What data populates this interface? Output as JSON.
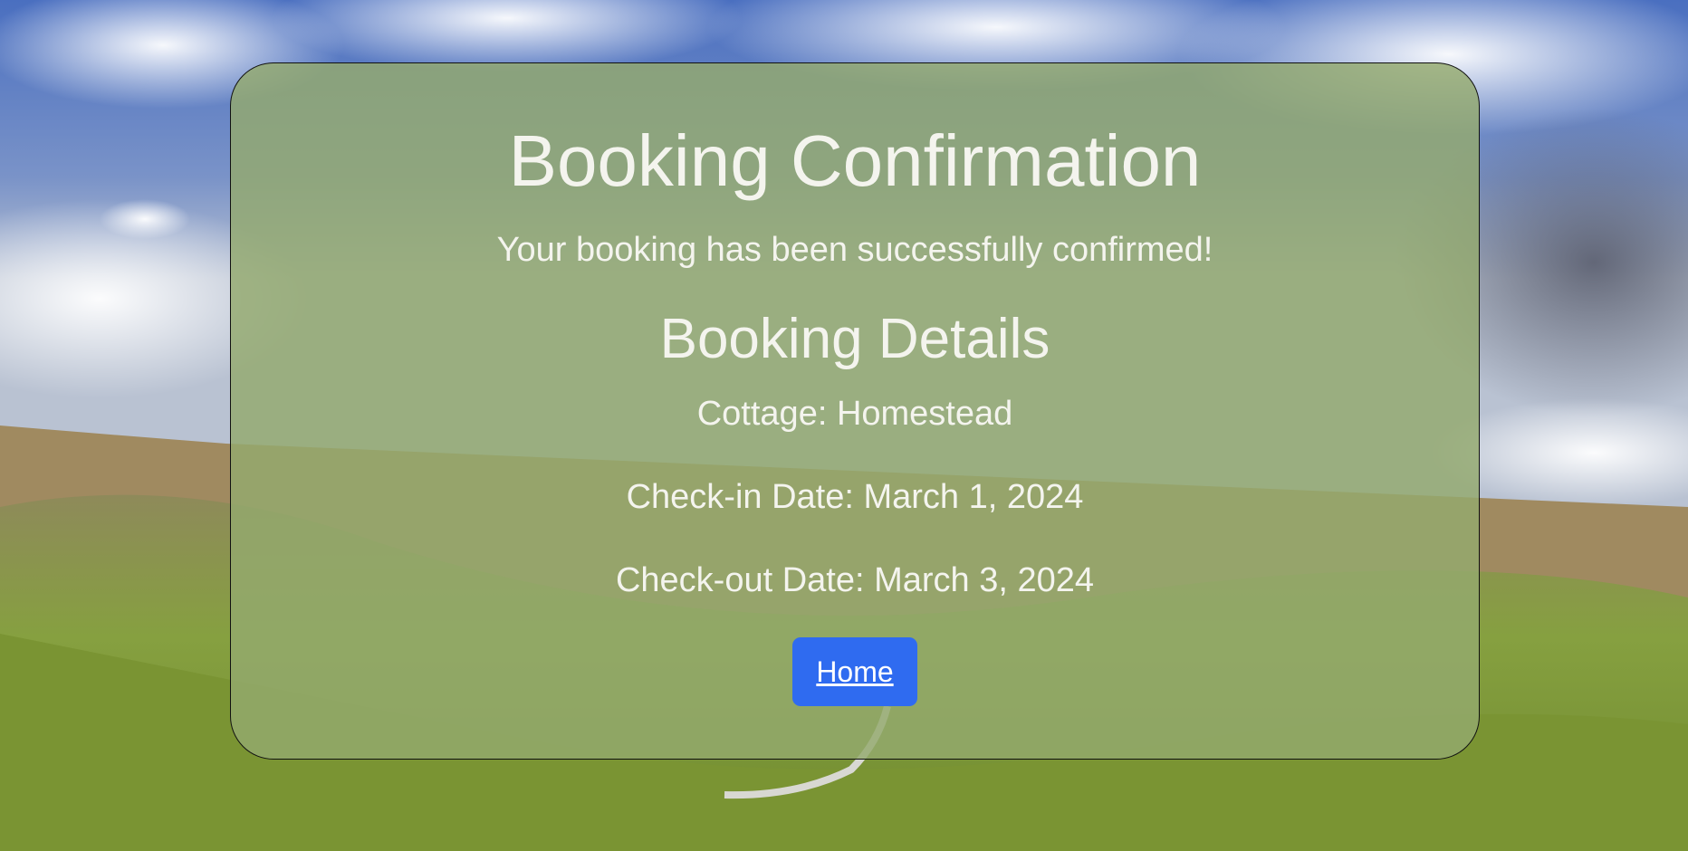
{
  "confirmation": {
    "title": "Booking Confirmation",
    "message": "Your booking has been successfully confirmed!"
  },
  "details": {
    "heading": "Booking Details",
    "cottage": "Cottage: Homestead",
    "check_in": "Check-in Date: March 1, 2024",
    "check_out": "Check-out Date: March 3, 2024"
  },
  "home_button": {
    "label": "Home"
  },
  "colors": {
    "card_overlay": "#94aa6e",
    "button": "#2f6bf0",
    "text": "#f4f4ee"
  }
}
